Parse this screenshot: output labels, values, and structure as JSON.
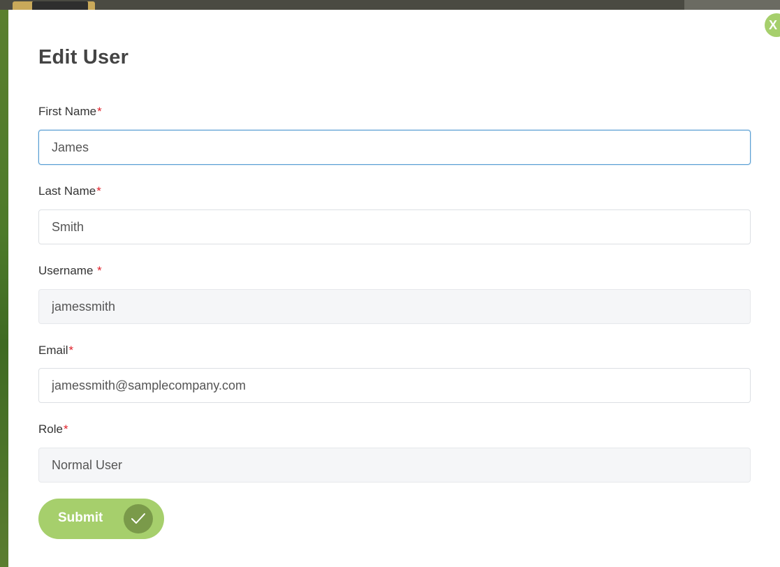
{
  "modal": {
    "title": "Edit User",
    "close_label": "X"
  },
  "fields": {
    "first_name": {
      "label": "First Name",
      "required_mark": "*",
      "value": "James"
    },
    "last_name": {
      "label": "Last Name",
      "required_mark": "*",
      "value": "Smith"
    },
    "username": {
      "label": "Username ",
      "required_mark": "*",
      "value": "jamessmith"
    },
    "email": {
      "label": "Email",
      "required_mark": "*",
      "value": "jamessmith@samplecompany.com"
    },
    "role": {
      "label": "Role",
      "required_mark": "*",
      "value": "Normal User"
    }
  },
  "submit": {
    "label": "Submit",
    "icon": "check-icon"
  },
  "colors": {
    "accent_green": "#a6cf6c",
    "check_circle": "#7a9a4a",
    "required_red": "#e0202a",
    "focus_blue": "#5a9fd4"
  }
}
